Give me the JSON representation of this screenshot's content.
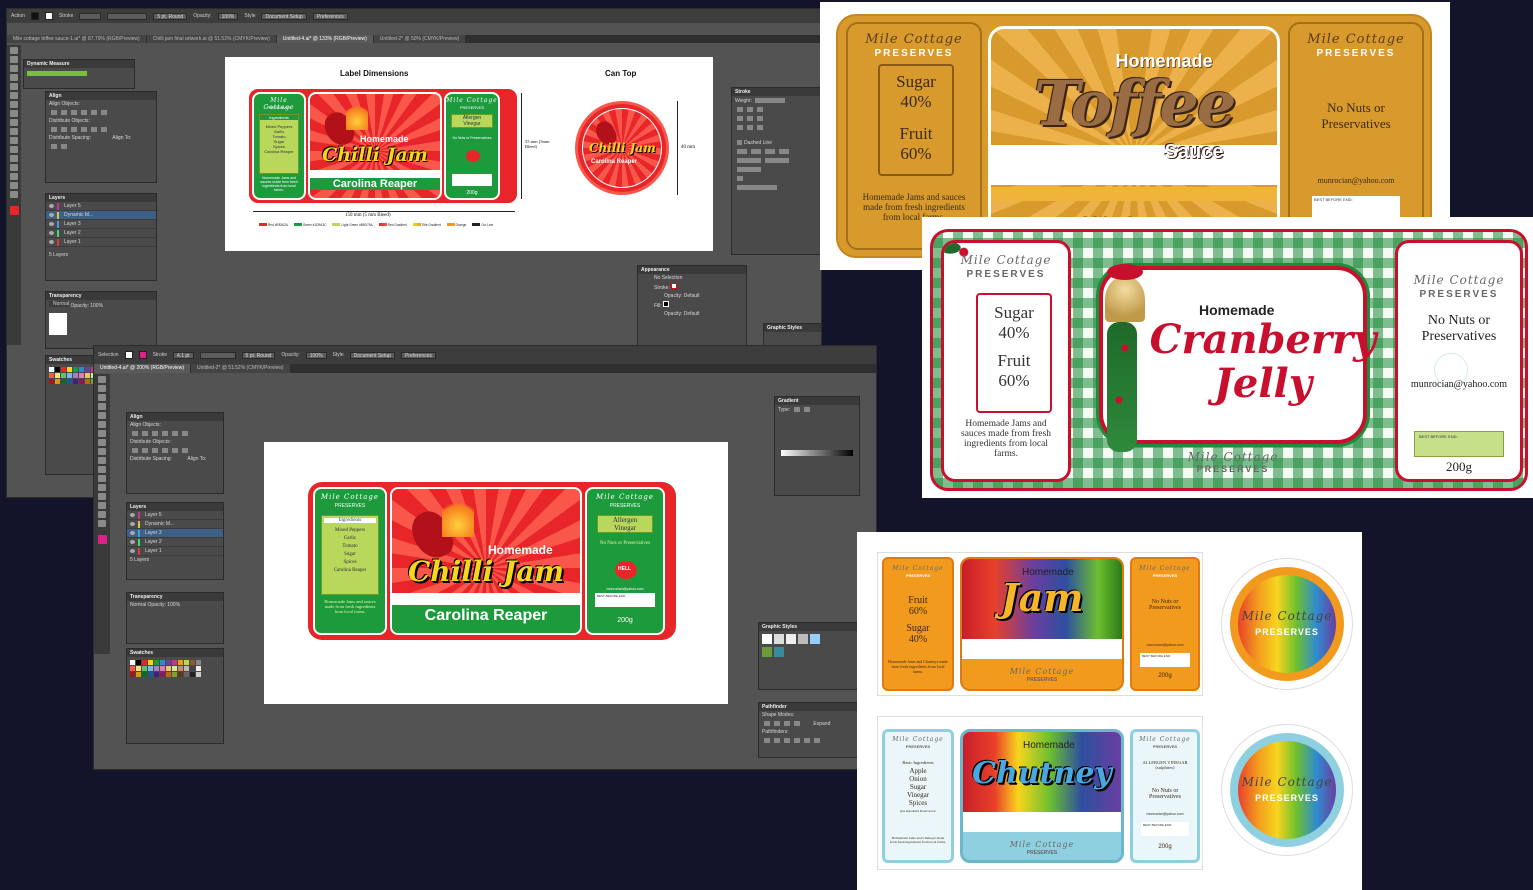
{
  "ai_window_1": {
    "tabs": [
      "Mile cottage toffee sauce-1.ai* @ 87.79% (RGB/Preview)",
      "Chilli jam final artwork.ai @ 51.52% (CMYK/Preview)",
      "Untitled-4.ai* @ 133% (RGB/Preview)",
      "Untitled-2* @ 50% (CMYK/Preview)"
    ],
    "control_bar": {
      "mode": "Action",
      "stroke_label": "Stroke",
      "brush": "5 pt. Round",
      "opacity_label": "Opacity:",
      "opacity": "100%",
      "style_label": "Style",
      "doc_setup": "Document Setup",
      "preferences": "Preferences"
    },
    "panels": {
      "dynamic_measure": "Dynamic Measure",
      "align": "Align",
      "align_objects": "Align Objects:",
      "distribute_objects": "Distribute Objects:",
      "distribute_spacing": "Distribute Spacing:",
      "align_to": "Align To:",
      "layers": "Layers",
      "layer_items": [
        "Layer 5",
        "Dynamic M...",
        "Layer 3",
        "Layer 2",
        "Layer 1"
      ],
      "layers_count": "5 Layers",
      "transparency": "Transparency",
      "blend_mode": "Normal",
      "opacity_label": "Opacity:",
      "opacity": "100%",
      "swatches": "Swatches",
      "stroke": "Stroke",
      "weight_label": "Weight:",
      "dashed_line": "Dashed Line",
      "appearance": "Appearance",
      "no_selection": "No Selection",
      "stroke_row": "Stroke:",
      "fill_row": "Fill:",
      "opacity_default": "Opacity: Default",
      "graphic_styles": "Graphic Styles"
    },
    "artboard": {
      "label_dimensions_title": "Label Dimensions",
      "can_top_title": "Can Top",
      "width_dim": "150 mm (5 mm Bleed)",
      "height_dim": "55 mm (5mm Bleed)",
      "can_dim": "40 mm",
      "legend": [
        "Red #E8262A",
        "Green #1D9A3C",
        "Light Green #B9D75A",
        "Red Gradient",
        "Title Gradient",
        "Orange",
        "Cut Line"
      ]
    }
  },
  "ai_window_2": {
    "tabs": [
      "Untitled-4.ai* @ 200% (RGB/Preview)",
      "Untitled-2* @ 51.52% (CMYK/Preview)"
    ],
    "control_bar": {
      "stroke_label": "Stroke",
      "stroke_weight": "4.1 pt",
      "brush": "5 pt. Round",
      "opacity_label": "Opacity:",
      "opacity": "100%",
      "style_label": "Style",
      "doc_setup": "Document Setup",
      "preferences": "Preferences"
    },
    "panels": {
      "align": "Align",
      "align_objects": "Align Objects:",
      "distribute_objects": "Distribute Objects:",
      "distribute_spacing": "Distribute Spacing:",
      "align_to": "Align To:",
      "layers": "Layers",
      "layer_items": [
        "Layer 5",
        "Dynamic M...",
        "Layer 3",
        "Layer 2",
        "Layer 1"
      ],
      "layers_count": "5 Layers",
      "transparency": "Transparency",
      "blend_mode": "Normal",
      "opacity_label": "Opacity:",
      "opacity": "100%",
      "swatches": "Swatches",
      "gradient": "Gradient",
      "type_label": "Type:",
      "graphic_styles": "Graphic Styles",
      "pathfinder": "Pathfinder",
      "shape_modes": "Shape Modes:",
      "pathfinders": "Pathfinders:",
      "expand": "Expand"
    }
  },
  "chilli_label": {
    "brand_line1": "Mile Cottage",
    "brand_line2": "PRESERVES",
    "ingredients_title": "Ingredients",
    "ingredients": [
      "Mixed Peppers",
      "Garlic",
      "Tomato",
      "Sugar",
      "Spices",
      "Carolina Reaper"
    ],
    "blurb": "Homemade Jams and sauces made from fresh ingredients from local farms.",
    "homemade": "Homemade",
    "title": "Chilli Jam",
    "subtitle": "Carolina Reaper",
    "allergen_title": "Allergen",
    "allergen_value": "Vinegar",
    "no_nuts": "No Nuts or Preservatives",
    "heat_badge": "HELL",
    "email": "munrocian@yahoo.com",
    "best_before": "BEST BEFORE END:",
    "weight": "200g"
  },
  "toffee_label": {
    "brand_line1": "Mile Cottage",
    "brand_line2": "PRESERVES",
    "sugar_label": "Sugar",
    "sugar_pct": "40%",
    "fruit_label": "Fruit",
    "fruit_pct": "60%",
    "blurb": "Homemade Jams and sauces made from fresh ingredients from local farms.",
    "homemade": "Homemade",
    "title": "Toffee",
    "subtitle": "Sauce",
    "no_nuts": "No Nuts or Preservatives",
    "email": "munrocian@yahoo.com",
    "best_before": "BEST BEFORE END:"
  },
  "cranberry_label": {
    "brand_line1": "Mile Cottage",
    "brand_line2": "PRESERVES",
    "sugar_label": "Sugar",
    "sugar_pct": "40%",
    "fruit_label": "Fruit",
    "fruit_pct": "60%",
    "blurb": "Homemade Jams and sauces made from fresh ingredients from local farms.",
    "homemade": "Homemade",
    "title_line1": "Cranberry",
    "title_line2": "Jelly",
    "no_nuts": "No Nuts or Preservatives",
    "email": "munrocian@yahoo.com",
    "best_before": "BEST BEFORE END:",
    "weight": "200g"
  },
  "jam_label": {
    "brand_line1": "Mile Cottage",
    "brand_line2": "PRESERVES",
    "fruit_label": "Fruit",
    "fruit_pct": "60%",
    "sugar_label": "Sugar",
    "sugar_pct": "40%",
    "blurb": "Homemade Jams and Chutneys made from fresh ingredients from local farms.",
    "homemade": "Homemade",
    "title": "Jam",
    "no_nuts": "No Nuts or Preservatives",
    "email": "munrocian@yahoo.com",
    "best_before": "BEST BEFORE END:",
    "weight": "200g"
  },
  "chutney_label": {
    "brand_line1": "Mile Cottage",
    "brand_line2": "PRESERVES",
    "ingredients_title": "Basic Ingredients",
    "ingredients": [
      "Apple",
      "Onion",
      "Sugar",
      "Vinegar",
      "Spices"
    ],
    "extra_note": "plus ingredients Preserved etc",
    "blurb": "Homemade Jams and Chutneys made from fresh ingredients from local farms.",
    "homemade": "Homemade",
    "title": "Chutney",
    "allergen": "ALLERGEN VINEGAR (sulphites)",
    "no_nuts": "No Nuts or Preservatives",
    "email": "munrocian@yahoo.com",
    "best_before": "BEST BEFORE END:",
    "weight": "200g"
  },
  "colors": {
    "background": "#13132a",
    "chilli_red": "#e8262a",
    "chilli_green": "#1d9a3c",
    "lime": "#b9d75a",
    "toffee_gold": "#d89a2c",
    "cranberry_red": "#c8102e",
    "plaid_green": "#1e8c3c",
    "jam_orange": "#f29a1e",
    "chutney_blue": "#8fd0e0"
  }
}
